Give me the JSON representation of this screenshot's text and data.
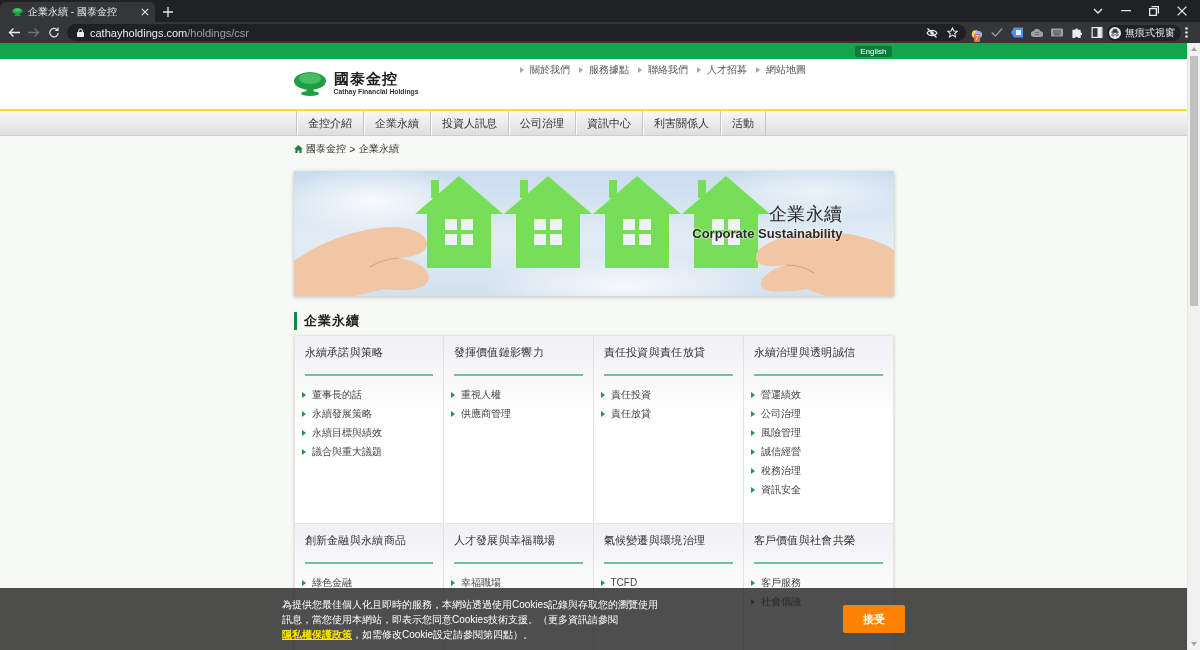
{
  "browser": {
    "tabs": [
      {
        "title": "企業永續 - 國泰金控",
        "selected": true
      }
    ],
    "forward_disabled": true,
    "url_host": "cathayholdings.com",
    "url_path": "/holdings/csr",
    "extension_badge": "7",
    "profile_label": "無痕式視窗"
  },
  "top_bar": {
    "language_button": "English"
  },
  "header": {
    "logo_name": "國泰金控",
    "logo_subtitle": "Cathay Financial Holdings",
    "links": [
      "關於我們",
      "服務據點",
      "聯絡我們",
      "人才招募",
      "網站地圖"
    ]
  },
  "nav": [
    "金控介紹",
    "企業永續",
    "投資人訊息",
    "公司治理",
    "資訊中心",
    "利害關係人",
    "活動"
  ],
  "breadcrumb": {
    "items": [
      {
        "label": "國泰金控",
        "kind": "home"
      },
      {
        "label": "企業永續",
        "kind": "current"
      }
    ],
    "separator": ">"
  },
  "banner": {
    "title": "企業永續",
    "subtitle": "Corporate Sustainability"
  },
  "section": {
    "title": "企業永續",
    "cards": [
      {
        "title": "永續承諾與策略",
        "items": [
          "董事長的話",
          "永續發展策略",
          "永續目標與績效",
          "議合與重大議題"
        ]
      },
      {
        "title": "發揮價值鏈影響力",
        "items": [
          "重視人權",
          "供應商管理"
        ]
      },
      {
        "title": "責任投資與責任放貸",
        "items": [
          "責任投資",
          "責任放貸"
        ]
      },
      {
        "title": "永續治理與透明誠信",
        "items": [
          "營運績效",
          "公司治理",
          "風險管理",
          "誠信經營",
          "稅務治理",
          "資訊安全"
        ]
      },
      {
        "title": "創新金融與永續商品",
        "items": [
          "綠色金融"
        ]
      },
      {
        "title": "人才發展與幸福職場",
        "items": [
          "幸福職場"
        ]
      },
      {
        "title": "氣候變遷與環境治理",
        "items": [
          "TCFD"
        ]
      },
      {
        "title": "客戶價值與社會共榮",
        "items": [
          "客戶服務",
          "社會倡議"
        ]
      }
    ]
  },
  "cookie_notice": {
    "text_before": "為提供您最佳個人化且即時的服務，本網站透過使用Cookies記錄與存取您的瀏覽使用訊息，當您使用本網站，即表示您同意Cookies技術支援。（更多資訊請參閱",
    "link": "隱私權保護政策",
    "text_after": "，如需修改Cookie設定請參閱第四點）。",
    "button": "接受"
  }
}
